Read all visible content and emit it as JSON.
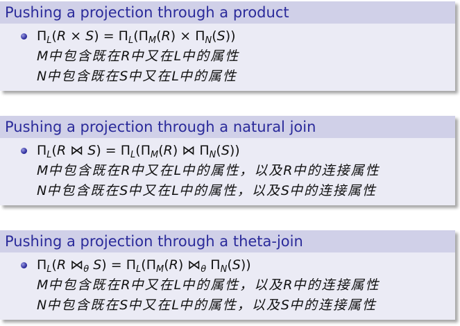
{
  "blocks": [
    {
      "title": "Pushing a projection through a product",
      "formula": {
        "pi": "Π",
        "L": "L",
        "lp": "(",
        "R": "R",
        "op": " × ",
        "S": "S",
        "rp": ")",
        "eq": " = ",
        "pi2": "Π",
        "L2": "L",
        "lp2": "(",
        "pi3": "Π",
        "M": "M",
        "R2": "R",
        "op2": " × ",
        "pi4": "Π",
        "N": "N",
        "S2": "S",
        "rp2": "))"
      },
      "line2": {
        "v": "M",
        "t1": "中包含既在",
        "v2": "R",
        "t2": "中又在",
        "v3": "L",
        "t3": "中的属性"
      },
      "line3": {
        "v": "N",
        "t1": "中包含既在",
        "v2": "S",
        "t2": "中又在",
        "v3": "L",
        "t3": "中的属性"
      }
    },
    {
      "title": "Pushing a projection through a natural join",
      "formula": {
        "pi": "Π",
        "L": "L",
        "lp": "(",
        "R": "R",
        "op": " ⋈ ",
        "S": "S",
        "rp": ")",
        "eq": " = ",
        "pi2": "Π",
        "L2": "L",
        "lp2": "(",
        "pi3": "Π",
        "M": "M",
        "R2": "R",
        "op2": " ⋈ ",
        "pi4": "Π",
        "N": "N",
        "S2": "S",
        "rp2": "))"
      },
      "line2": {
        "v": "M",
        "t1": "中包含既在",
        "v2": "R",
        "t2": "中又在",
        "v3": "L",
        "t3": "中的属性，以及",
        "v4": "R",
        "t4": "中的连接属性"
      },
      "line3": {
        "v": "N",
        "t1": "中包含既在",
        "v2": "S",
        "t2": "中又在",
        "v3": "L",
        "t3": "中的属性，以及",
        "v4": "S",
        "t4": "中的连接属性"
      }
    },
    {
      "title": "Pushing a projection through a theta-join",
      "formula": {
        "pi": "Π",
        "L": "L",
        "lp": "(",
        "R": "R",
        "op": " ⋈",
        "theta": "θ",
        "S": " S",
        "rp": ")",
        "eq": " = ",
        "pi2": "Π",
        "L2": "L",
        "lp2": "(",
        "pi3": "Π",
        "M": "M",
        "R2": "R",
        "op2": " ⋈",
        "theta2": "θ",
        "pi4": " Π",
        "N": "N",
        "S2": "S",
        "rp2": "))"
      },
      "line2": {
        "v": "M",
        "t1": "中包含既在",
        "v2": "R",
        "t2": "中又在",
        "v3": "L",
        "t3": "中的属性，以及",
        "v4": "R",
        "t4": "中的连接属性"
      },
      "line3": {
        "v": "N",
        "t1": "中包含既在",
        "v2": "S",
        "t2": "中又在",
        "v3": "L",
        "t3": "中的属性，以及",
        "v4": "S",
        "t4": "中的连接属性"
      }
    }
  ]
}
